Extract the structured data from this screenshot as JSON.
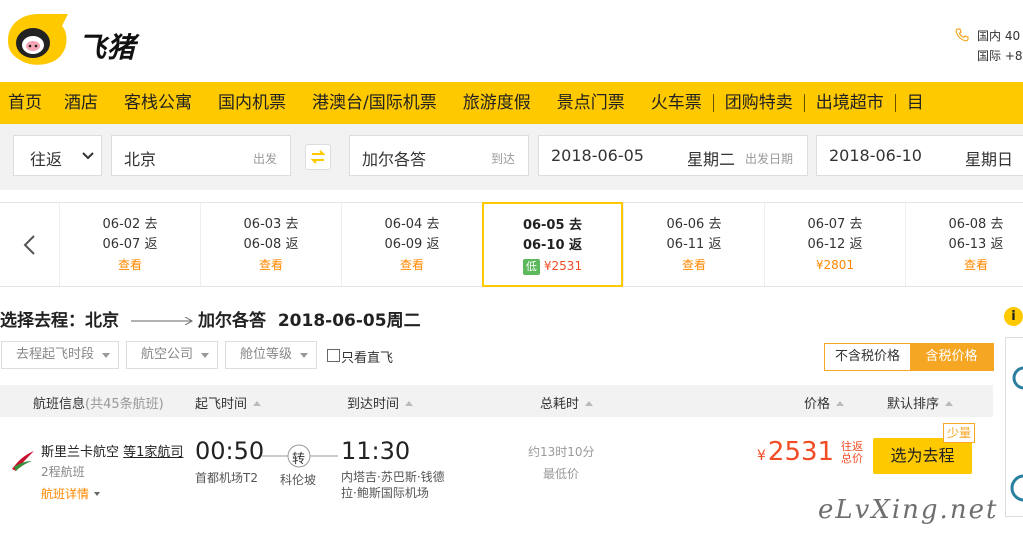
{
  "brand": {
    "name": "飞猪",
    "accent": "#ffc900"
  },
  "hotline": {
    "domestic": "国内 40",
    "international": "国际 +8"
  },
  "nav": {
    "items": [
      "首页",
      "酒店",
      "客栈公寓",
      "国内机票",
      "港澳台/国际机票",
      "旅游度假",
      "景点门票",
      "火车票",
      "团购特卖",
      "出境超市",
      "目"
    ]
  },
  "search": {
    "trip_type": "往返",
    "from": {
      "value": "北京",
      "hint": "出发"
    },
    "to": {
      "value": "加尔各答",
      "hint": "到达"
    },
    "depart": {
      "date": "2018-06-05",
      "weekday": "星期二",
      "hint": "出发日期"
    },
    "return": {
      "date": "2018-06-10",
      "weekday": "星期日"
    }
  },
  "date_strip": [
    {
      "go": "06-02 去",
      "back": "06-07 返",
      "price": "查看"
    },
    {
      "go": "06-03 去",
      "back": "06-08 返",
      "price": "查看"
    },
    {
      "go": "06-04 去",
      "back": "06-09 返",
      "price": "查看"
    },
    {
      "go": "06-05 去",
      "back": "06-10 返",
      "price": "¥2531",
      "badge": "低",
      "active": true
    },
    {
      "go": "06-06 去",
      "back": "06-11 返",
      "price": "查看"
    },
    {
      "go": "06-07 去",
      "back": "06-12 返",
      "price": "¥2801"
    },
    {
      "go": "06-08 去",
      "back": "06-13 返",
      "price": "查看"
    }
  ],
  "route": {
    "prefix": "选择去程：北京",
    "dest": "加尔各答",
    "date": "2018-06-05周二"
  },
  "filters": {
    "depart_time": "去程起飞时段",
    "airline": "航空公司",
    "cabin": "舱位等级",
    "direct_only": "只看直飞"
  },
  "price_toggle": {
    "excl_tax": "不含税价格",
    "incl_tax": "含税价格"
  },
  "table_header": {
    "flight_info": "航班信息",
    "flight_count": "(共45条航班)",
    "depart_time": "起飞时间",
    "arrive_time": "到达时间",
    "duration": "总耗时",
    "price": "价格",
    "sort": "默认排序"
  },
  "flight": {
    "airline": "斯里兰卡航空",
    "airline_more": "等1家航司",
    "cabin": "2程航班",
    "details": "航班详情",
    "depart_time": "00:50",
    "depart_airport": "首都机场T2",
    "transfer_label": "转",
    "transfer_city": "科伦坡",
    "arrive_time": "11:30",
    "arrive_airport": "内塔吉·苏巴斯·钱德拉·鲍斯国际机场",
    "duration": "约13时10分",
    "duration_note": "最低价",
    "currency": "¥",
    "price": "2531",
    "price_note": "往返总价",
    "book": "选为去程",
    "stock_tag": "少量"
  },
  "side": {
    "info": "i"
  },
  "watermark": "eLvXing.net"
}
